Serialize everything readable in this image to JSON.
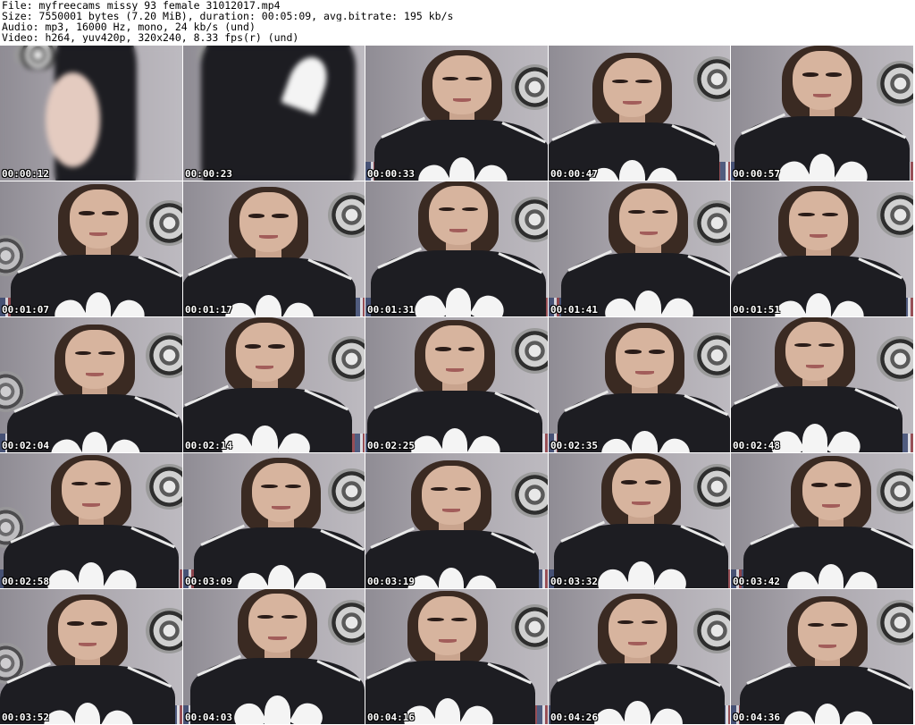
{
  "header": {
    "file_line": "File: myfreecams_missy_93_female_31012017.mp4",
    "size_line": "Size: 7550001 bytes (7.20 MiB), duration: 00:05:09, avg.bitrate: 195 kb/s",
    "audio_line": "Audio: mp3, 16000 Hz, mono, 24 kb/s (und)",
    "video_line": "Video: h264, yuv420p, 320x240, 8.33 fps(r) (und)"
  },
  "thumbnails": [
    {
      "timestamp": "00:00:12"
    },
    {
      "timestamp": "00:00:23"
    },
    {
      "timestamp": "00:00:33"
    },
    {
      "timestamp": "00:00:47"
    },
    {
      "timestamp": "00:00:57"
    },
    {
      "timestamp": "00:01:07"
    },
    {
      "timestamp": "00:01:17"
    },
    {
      "timestamp": "00:01:31"
    },
    {
      "timestamp": "00:01:41"
    },
    {
      "timestamp": "00:01:51"
    },
    {
      "timestamp": "00:02:04"
    },
    {
      "timestamp": "00:02:14"
    },
    {
      "timestamp": "00:02:25"
    },
    {
      "timestamp": "00:02:35"
    },
    {
      "timestamp": "00:02:48"
    },
    {
      "timestamp": "00:02:58"
    },
    {
      "timestamp": "00:03:09"
    },
    {
      "timestamp": "00:03:19"
    },
    {
      "timestamp": "00:03:32"
    },
    {
      "timestamp": "00:03:42"
    },
    {
      "timestamp": "00:03:52"
    },
    {
      "timestamp": "00:04:03"
    },
    {
      "timestamp": "00:04:16"
    },
    {
      "timestamp": "00:04:26"
    },
    {
      "timestamp": "00:04:36"
    }
  ],
  "colors": {
    "background": "#ffffff",
    "header_text": "#000000",
    "timestamp_text": "#ffffff"
  }
}
